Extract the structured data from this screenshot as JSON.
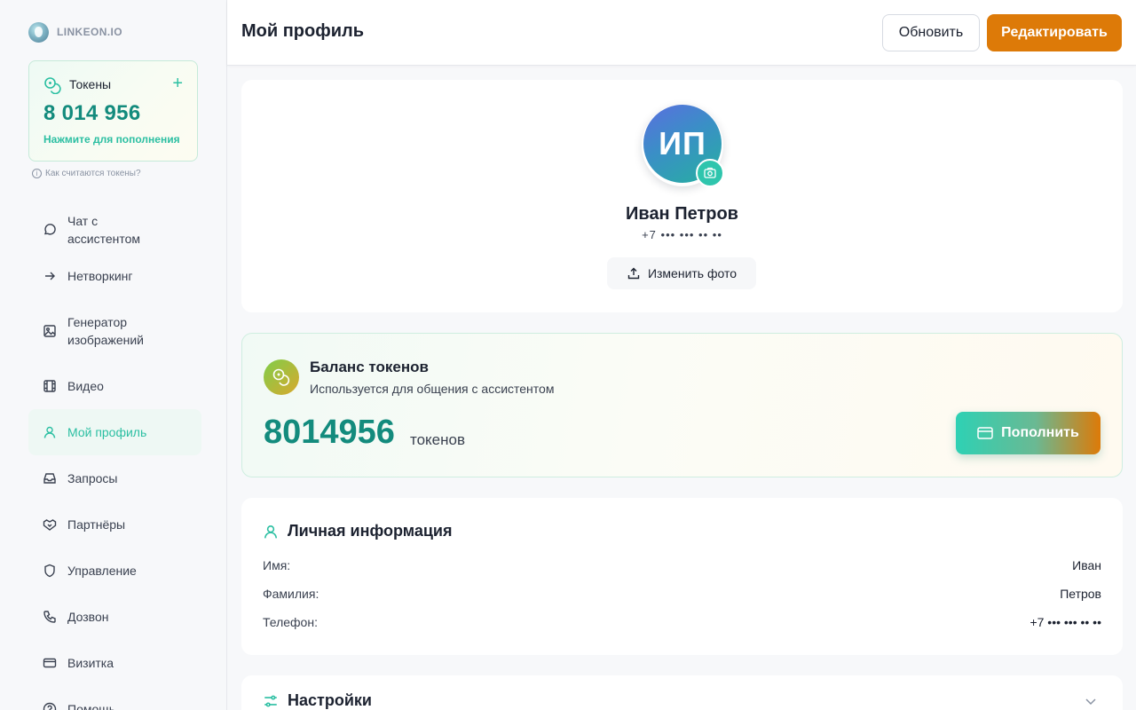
{
  "brand": {
    "name": "LINKEON.IO"
  },
  "sidebar": {
    "tokens": {
      "title": "Токены",
      "value": "8 014 956",
      "hint": "Нажмите для пополнения",
      "add_icon": "plus-icon"
    },
    "tokens_help": "Как считаются токены?",
    "items": [
      {
        "label": "Чат с ассистентом",
        "icon": "chat-icon"
      },
      {
        "label": "Нетворкинг",
        "icon": "arrow-right-icon"
      },
      {
        "label": "Генератор изображений",
        "icon": "image-icon"
      },
      {
        "label": "Видео",
        "icon": "film-icon"
      },
      {
        "label": "Мой профиль",
        "icon": "user-icon",
        "active": true
      },
      {
        "label": "Запросы",
        "icon": "inbox-icon"
      },
      {
        "label": "Партнёры",
        "icon": "handshake-icon"
      },
      {
        "label": "Управление",
        "icon": "shield-icon"
      },
      {
        "label": "Дозвон",
        "icon": "phone-icon"
      },
      {
        "label": "Визитка",
        "icon": "card-icon"
      },
      {
        "label": "Помощь",
        "icon": "help-icon"
      }
    ]
  },
  "header": {
    "title": "Мой профиль",
    "refresh_label": "Обновить",
    "edit_label": "Редактировать"
  },
  "profile": {
    "initials": "ИП",
    "name": "Иван Петров",
    "phone": "+7 ••• ••• •• ••",
    "change_photo_label": "Изменить фото"
  },
  "balance": {
    "title": "Баланс токенов",
    "subtitle": "Используется для общения с ассистентом",
    "value": "8014956",
    "unit": "токенов",
    "topup_label": "Пополнить"
  },
  "personal_info": {
    "title": "Личная информация",
    "rows": [
      {
        "label": "Имя:",
        "value": "Иван"
      },
      {
        "label": "Фамилия:",
        "value": "Петров"
      },
      {
        "label": "Телефон:",
        "value": "+7 ••• ••• •• ••"
      }
    ]
  },
  "settings": {
    "title": "Настройки"
  },
  "colors": {
    "accent_teal": "#2bbfa2",
    "accent_dark_teal": "#138b7d",
    "accent_orange": "#dd7a08"
  }
}
